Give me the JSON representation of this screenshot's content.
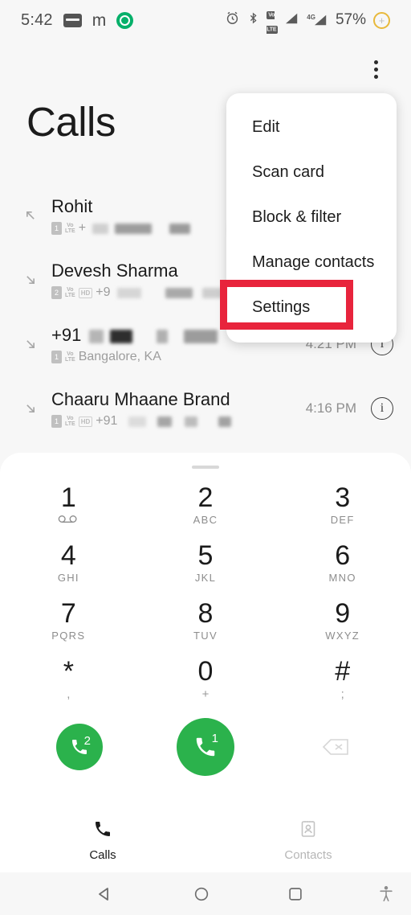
{
  "statusbar": {
    "time": "5:42",
    "left_icons": [
      "wallet-icon",
      "m-app-icon",
      "green-circle-icon"
    ],
    "m_glyph": "m",
    "right_icons": [
      "alarm-icon",
      "bluetooth-icon",
      "volte-sim-icon",
      "signal-sim1-icon",
      "signal-4g-sim2-icon"
    ],
    "volte_label_top": "Vo",
    "volte_label_bottom": "LTE",
    "network_label": "4G",
    "battery_percent": "57%",
    "battery_icon": "battery-charging-icon"
  },
  "header": {
    "title": "Calls",
    "overflow_icon": "more-vert-icon"
  },
  "menu": {
    "items": [
      {
        "label": "Edit",
        "name": "menu-item-edit"
      },
      {
        "label": "Scan card",
        "name": "menu-item-scan-card"
      },
      {
        "label": "Block & filter",
        "name": "menu-item-block-filter"
      },
      {
        "label": "Manage contacts",
        "name": "menu-item-manage-contacts"
      },
      {
        "label": "Settings",
        "name": "menu-item-settings"
      }
    ],
    "highlighted": "Settings",
    "highlight_color": "#e8243c"
  },
  "calls": [
    {
      "name": "Rohit",
      "direction": "outgoing",
      "direction_icon": "call-made-icon",
      "sim": "1",
      "volte": true,
      "hd": false,
      "subtitle": "+",
      "subtitle_redacted": true,
      "time": "",
      "has_info": false
    },
    {
      "name": "Devesh Sharma",
      "direction": "incoming",
      "direction_icon": "call-received-icon",
      "sim": "2",
      "volte": true,
      "hd": true,
      "subtitle": "+9",
      "subtitle_redacted": true,
      "time": "",
      "has_info": false
    },
    {
      "name": "+91",
      "name_redacted": true,
      "direction": "incoming",
      "direction_icon": "call-received-icon",
      "sim": "1",
      "volte": true,
      "hd": false,
      "subtitle": "Bangalore, KA",
      "subtitle_redacted": false,
      "time": "4:21 PM",
      "has_info": true
    },
    {
      "name": "Chaaru Mhaane Brand",
      "direction": "incoming",
      "direction_icon": "call-received-icon",
      "sim": "1",
      "volte": true,
      "hd": true,
      "subtitle": "+91",
      "subtitle_redacted": true,
      "time": "4:16 PM",
      "has_info": true
    }
  ],
  "dialpad": {
    "grabber_icon": "drag-handle-icon",
    "keys": [
      {
        "digit": "1",
        "sub": "∞",
        "sub_kind": "voicemail",
        "name": "dialpad-key-1"
      },
      {
        "digit": "2",
        "sub": "ABC",
        "sub_kind": "letters",
        "name": "dialpad-key-2"
      },
      {
        "digit": "3",
        "sub": "DEF",
        "sub_kind": "letters",
        "name": "dialpad-key-3"
      },
      {
        "digit": "4",
        "sub": "GHI",
        "sub_kind": "letters",
        "name": "dialpad-key-4"
      },
      {
        "digit": "5",
        "sub": "JKL",
        "sub_kind": "letters",
        "name": "dialpad-key-5"
      },
      {
        "digit": "6",
        "sub": "MNO",
        "sub_kind": "letters",
        "name": "dialpad-key-6"
      },
      {
        "digit": "7",
        "sub": "PQRS",
        "sub_kind": "letters",
        "name": "dialpad-key-7"
      },
      {
        "digit": "8",
        "sub": "TUV",
        "sub_kind": "letters",
        "name": "dialpad-key-8"
      },
      {
        "digit": "9",
        "sub": "WXYZ",
        "sub_kind": "letters",
        "name": "dialpad-key-9"
      },
      {
        "digit": "*",
        "sub": ",",
        "sub_kind": "symbol",
        "name": "dialpad-key-star"
      },
      {
        "digit": "0",
        "sub": "+",
        "sub_kind": "symbol",
        "name": "dialpad-key-0"
      },
      {
        "digit": "#",
        "sub": ";",
        "sub_kind": "symbol",
        "name": "dialpad-key-hash"
      }
    ],
    "call_sim2_badge": "2",
    "call_sim1_badge": "1",
    "call_icon": "phone-icon",
    "backspace_icon": "backspace-icon",
    "call_button_color": "#2bb24c"
  },
  "tabs": [
    {
      "label": "Calls",
      "icon": "phone-icon",
      "active": true,
      "name": "tab-calls"
    },
    {
      "label": "Contacts",
      "icon": "contacts-icon",
      "active": false,
      "name": "tab-contacts"
    }
  ],
  "navbar": {
    "back_icon": "nav-back-icon",
    "home_icon": "nav-home-icon",
    "recents_icon": "nav-recents-icon",
    "accessibility_icon": "accessibility-icon"
  }
}
